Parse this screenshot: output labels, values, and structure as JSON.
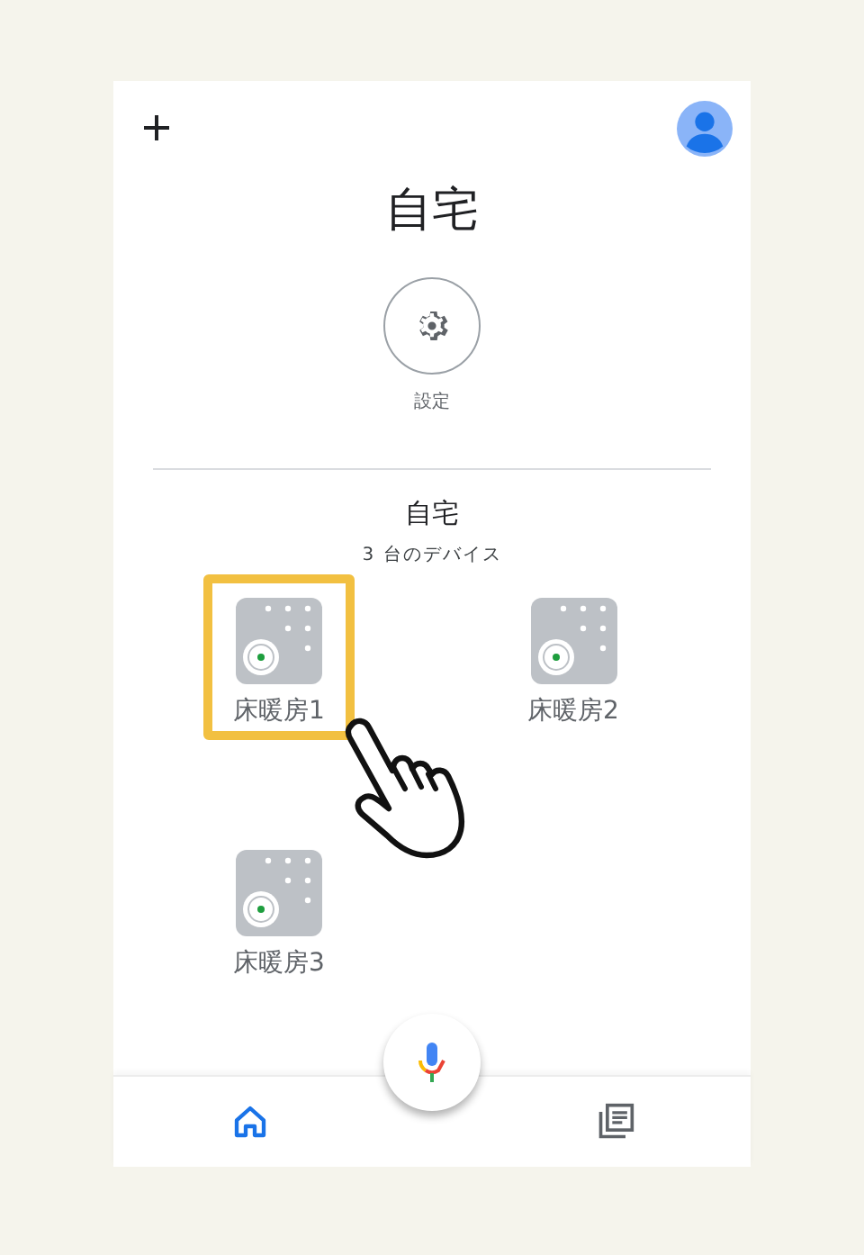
{
  "header": {
    "title": "自宅"
  },
  "shortcuts": [
    {
      "kind": "settings",
      "label": "設定"
    }
  ],
  "room": {
    "name": "自宅",
    "device_count": "3 台のデバイス"
  },
  "devices": [
    {
      "name": "床暖房1",
      "selected": true
    },
    {
      "name": "床暖房2",
      "selected": false
    },
    {
      "name": "床暖房3",
      "selected": false
    }
  ],
  "nav": [
    {
      "kind": "home",
      "selected": true
    },
    {
      "kind": "feed",
      "selected": false
    }
  ]
}
